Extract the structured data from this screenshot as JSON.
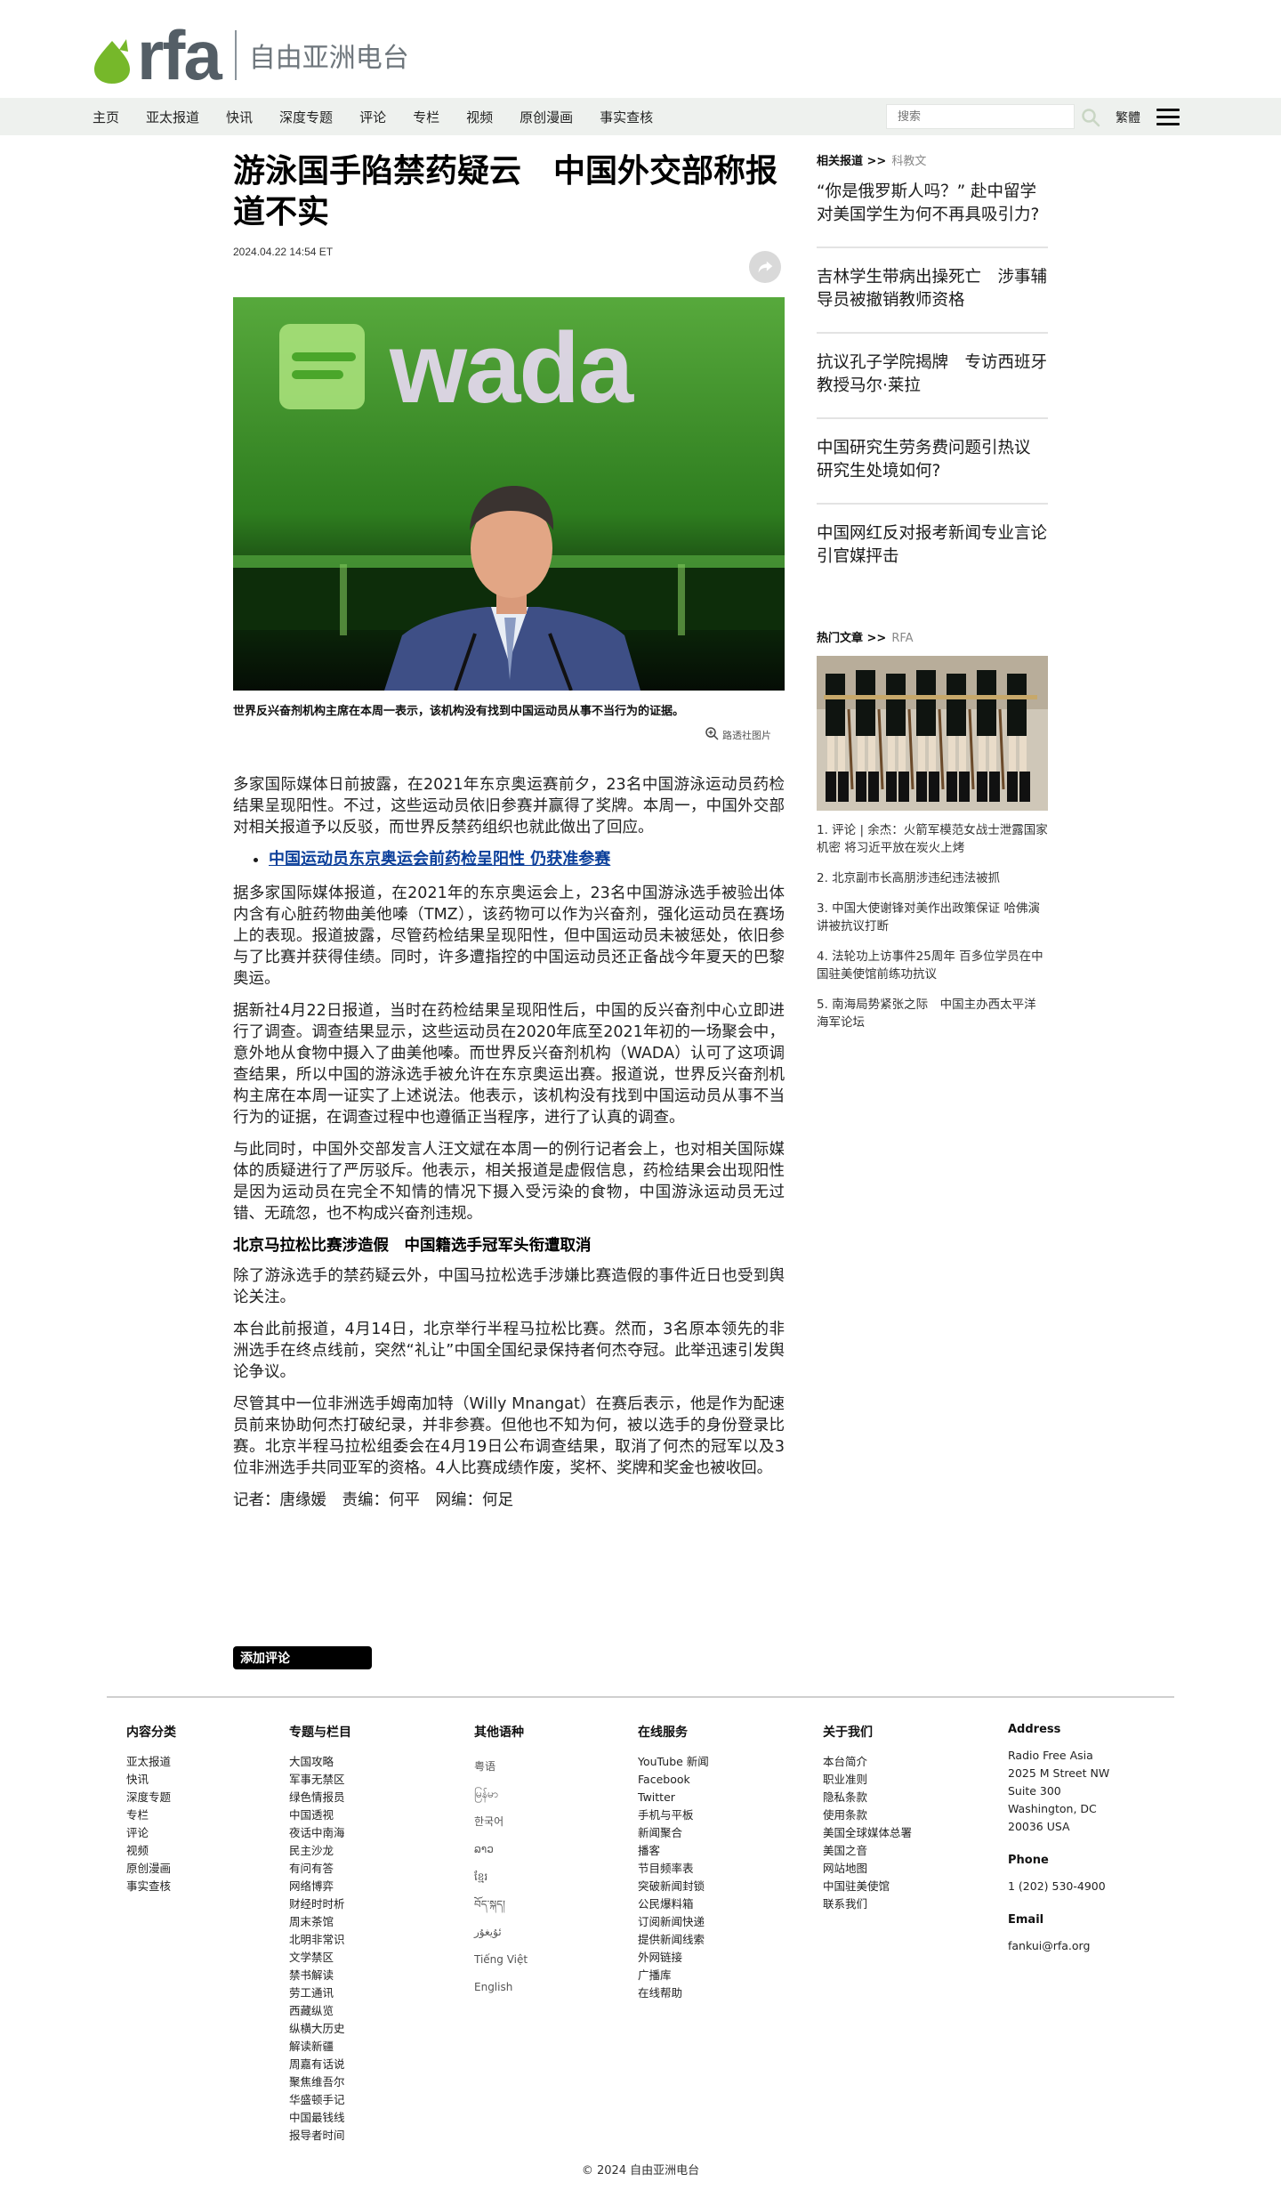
{
  "header": {
    "logo_text": "rfa",
    "logo_subtitle": "自由亚洲电台",
    "brand_color": "#76b82a"
  },
  "nav": {
    "items": [
      "主页",
      "亚太报道",
      "快讯",
      "深度专题",
      "评论",
      "专栏",
      "视频",
      "原创漫画",
      "事实查核"
    ],
    "search_placeholder": "搜索",
    "traditional_label": "繁體"
  },
  "article": {
    "headline": "游泳国手陷禁药疑云　中国外交部称报道不实",
    "date": "2024.04.22 14:54 ET",
    "image_logo_text": "wada",
    "caption": "世界反兴奋剂机构主席在本周一表示，该机构没有找到中国运动员从事不当行为的证据。",
    "credit": "路透社图片",
    "paragraphs_top": [
      "多家国际媒体日前披露，在2021年东京奥运赛前夕，23名中国游泳运动员药检结果呈现阳性。不过，这些运动员依旧参赛并赢得了奖牌。本周一，中国外交部对相关报道予以反驳，而世界反禁药组织也就此做出了回应。"
    ],
    "related_link": "中国运动员东京奥运会前药检呈阳性 仍获准参赛",
    "paragraphs_mid": [
      "据多家国际媒体报道，在2021年的东京奥运会上，23名中国游泳选手被验出体内含有心脏药物曲美他嗪（TMZ），该药物可以作为兴奋剂，强化运动员在赛场上的表现。报道披露，尽管药检结果呈现阳性，但中国运动员未被惩处，依旧参与了比赛并获得佳绩。同时，许多遭指控的中国运动员还正备战今年夏天的巴黎奥运。",
      "据新社4月22日报道，当时在药检结果呈现阳性后，中国的反兴奋剂中心立即进行了调查。调查结果显示，这些运动员在2020年底至2021年初的一场聚会中，意外地从食物中摄入了曲美他嗪。而世界反兴奋剂机构（WADA）认可了这项调查结果，所以中国的游泳选手被允许在东京奥运出赛。报道说，世界反兴奋剂机构主席在本周一证实了上述说法。他表示，该机构没有找到中国运动员从事不当行为的证据，在调查过程中也遵循正当程序，进行了认真的调查。",
      "与此同时，中国外交部发言人汪文斌在本周一的例行记者会上，也对相关国际媒体的质疑进行了严厉驳斥。他表示，相关报道是虚假信息，药检结果会出现阳性是因为运动员在完全不知情的情况下摄入受污染的食物，中国游泳运动员无过错、无疏忽，也不构成兴奋剂违规。"
    ],
    "subhead": "北京马拉松比赛涉造假　中国籍选手冠军头衔遭取消",
    "paragraphs_bottom": [
      "除了游泳选手的禁药疑云外，中国马拉松选手涉嫌比赛造假的事件近日也受到舆论关注。",
      "本台此前报道，4月14日，北京举行半程马拉松比赛。然而，3名原本领先的非洲选手在终点线前，突然“礼让”中国全国纪录保持者何杰夺冠。此举迅速引发舆论争议。",
      "尽管其中一位非洲选手姆南加特（Willy Mnangat）在赛后表示，他是作为配速员前来协助何杰打破纪录，并非参赛。但他也不知为何，被以选手的身份登录比赛。北京半程马拉松组委会在4月19日公布调查结果，取消了何杰的冠军以及3位非洲选手共同亚军的资格。4人比赛成绩作废，奖杯、奖牌和奖金也被收回。"
    ],
    "byline": "记者：唐缘媛　责编：何平　网编：何足",
    "comment_button": "添加评论"
  },
  "sidebar": {
    "related_label": "相关报道 >>",
    "related_tag": "科教文",
    "related_items": [
      "“你是俄罗斯人吗？” 赴中留学对美国学生为何不再具吸引力?",
      "吉林学生带病出操死亡　涉事辅导员被撤销教师资格",
      "抗议孔子学院揭牌　专访西班牙教授马尔·莱拉",
      "中国研究生劳务费问题引热议 研究生处境如何?",
      "中国网红反对报考新闻专业言论引官媒抨击"
    ],
    "hot_label": "热门文章 >>",
    "hot_tag": "RFA",
    "hot_items": [
      "1. 评论 | 余杰：火箭军模范女战士泄露国家机密 将习近平放在炭火上烤",
      "2. 北京副市长高朋涉违纪违法被抓",
      "3. 中国大使谢锋对美作出政策保证 哈佛演讲被抗议打断",
      "4. 法轮功上访事件25周年 百多位学员在中国驻美使馆前练功抗议",
      "5. 南海局势紧张之际　中国主办西太平洋海军论坛"
    ]
  },
  "footer": {
    "col1": {
      "title": "内容分类",
      "items": [
        "亚太报道",
        "快讯",
        "深度专题",
        "专栏",
        "评论",
        "视频",
        "原创漫画",
        "事实查核"
      ]
    },
    "col2": {
      "title": "专题与栏目",
      "items": [
        "大国攻略",
        "军事无禁区",
        "绿色情报员",
        "中国透视",
        "夜话中南海",
        "民主沙龙",
        "有问有答",
        "网络博弈",
        "财经时时析",
        "周末茶馆",
        "北明非常识",
        "文学禁区",
        "禁书解读",
        "劳工通讯",
        "西藏纵览",
        "纵横大历史",
        "解读新疆",
        "周嘉有话说",
        "聚焦维吾尔",
        "华盛顿手记",
        "中国最钱线",
        "报导者时间"
      ]
    },
    "col3": {
      "title": "其他语种",
      "items": [
        "粤语",
        "မြန်မာ",
        "한국어",
        "ລາວ",
        "ខ្មែរ",
        "བོད་སྐད།",
        "ئۇيغۇر",
        "Tiếng Việt",
        "English"
      ]
    },
    "col4": {
      "title": "在线服务",
      "items": [
        "YouTube 新闻",
        "Facebook",
        "Twitter",
        "手机与平板",
        "新闻聚合",
        "播客",
        "节目频率表",
        "突破新闻封锁",
        "公民爆料箱",
        "订阅新闻快递",
        "提供新闻线索",
        "外网链接",
        "广播库",
        "在线帮助"
      ]
    },
    "col5": {
      "title": "关于我们",
      "items": [
        "本台简介",
        "职业准则",
        "隐私条款",
        "使用条款",
        "美国全球媒体总署",
        "美国之音",
        "网站地图",
        "中国驻美使馆",
        "联系我们"
      ]
    },
    "address": {
      "title": "Address",
      "lines": [
        "Radio Free Asia",
        "2025 M Street NW",
        "Suite 300",
        "Washington, DC",
        "20036 USA"
      ],
      "phone_title": "Phone",
      "phone": "1 (202) 530-4900",
      "email_title": "Email",
      "email": "fankui@rfa.org"
    },
    "copyright": "© 2024 自由亚洲电台"
  }
}
